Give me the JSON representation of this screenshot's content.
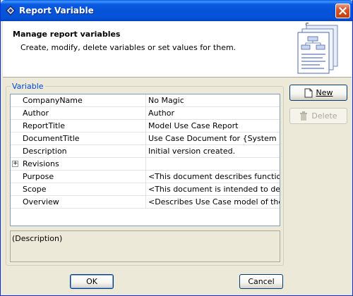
{
  "window": {
    "title": "Report Variable",
    "titlebar_color": "#0553d9"
  },
  "header": {
    "title": "Manage report variables",
    "subtitle": "Create, modify, delete variables or set values for them."
  },
  "variables": {
    "group_label": "Variable",
    "rows": [
      {
        "name": "CompanyName",
        "value": "No Magic",
        "expandable": false
      },
      {
        "name": "Author",
        "value": "Author",
        "expandable": false
      },
      {
        "name": "ReportTitle",
        "value": "Model Use Case Report",
        "expandable": false
      },
      {
        "name": "DocumentTitle",
        "value": "Use Case Document for {System name",
        "expandable": false
      },
      {
        "name": "Description",
        "value": "Initial version created.",
        "expandable": false
      },
      {
        "name": "Revisions",
        "value": "",
        "expandable": true
      },
      {
        "name": "Purpose",
        "value": "<This document describes functionality",
        "expandable": false
      },
      {
        "name": "Scope",
        "value": "<This document is intended to define u",
        "expandable": false
      },
      {
        "name": "Overview",
        "value": "<Describes Use Case model of the syst",
        "expandable": false
      }
    ],
    "description_text": "(Description)"
  },
  "buttons": {
    "new_label": "New",
    "delete_label": "Delete",
    "ok_label": "OK",
    "cancel_label": "Cancel"
  },
  "icons": {
    "app": "magicdraw-icon",
    "close": "close-icon",
    "header_art": "report-documents-icon",
    "new": "new-document-icon",
    "delete": "trash-icon"
  }
}
